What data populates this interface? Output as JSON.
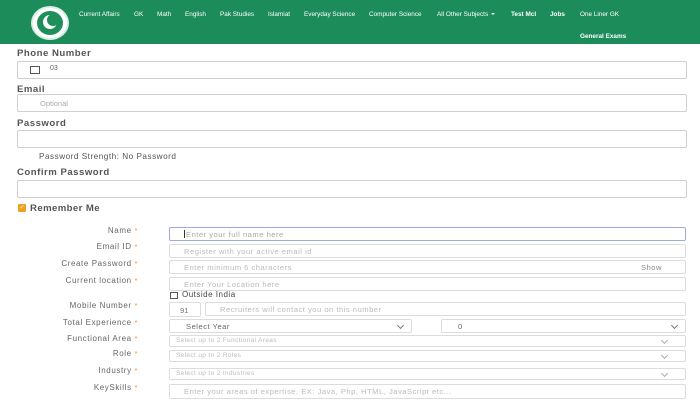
{
  "nav": {
    "items": [
      {
        "label": "Current Affairs",
        "bold": false
      },
      {
        "label": "GK",
        "bold": false
      },
      {
        "label": "Math",
        "bold": false
      },
      {
        "label": "English",
        "bold": false
      },
      {
        "label": "Pak Studies",
        "bold": false
      },
      {
        "label": "Islamiat",
        "bold": false
      },
      {
        "label": "Everyday Science",
        "bold": false
      },
      {
        "label": "Computer Science",
        "bold": false
      },
      {
        "label": "All Other Subjects",
        "bold": false,
        "dropdown": true
      },
      {
        "label": "Test Mcl",
        "bold": true
      },
      {
        "label": "Jobs",
        "bold": true
      },
      {
        "label": "One Liner GK",
        "bold": false
      }
    ],
    "second_row": "General Exams",
    "bg_color": "#1c8c5a"
  },
  "login": {
    "phone_label": "Phone Number",
    "phone_prefix": "03",
    "email_label": "Email",
    "email_placeholder": "Optional",
    "password_label": "Password",
    "password_strength": "Password Strength: No Password",
    "confirm_label": "Confirm Password",
    "remember_label": "Remember Me"
  },
  "register": {
    "name_label": "Name",
    "name_placeholder": "Enter your full name here",
    "email_label": "Email ID",
    "email_placeholder": "Register with your active email id",
    "password_label": "Create Password",
    "password_placeholder": "Enter minimum 6 characters",
    "show_label": "Show",
    "location_label": "Current location",
    "location_placeholder": "Enter Your Location here",
    "outside_label": "Outside India",
    "mobile_label": "Mobile Number",
    "mobile_code": "91",
    "mobile_placeholder": "Recruiters will contact you on this number",
    "experience_label": "Total Experience",
    "experience_year": "Select Year",
    "experience_month": "0",
    "functional_label": "Functional Area",
    "functional_placeholder": "Select up to 2 Functional Areas",
    "role_label": "Role",
    "role_placeholder": "Select up to 2 Roles",
    "industry_label": "Industry",
    "industry_placeholder": "Select up to 2 Industries",
    "skills_label": "KeySkills",
    "skills_placeholder": "Enter your areas of expertise. EX: Java, Php, HTML, JavaScript etc...",
    "required_mark": "*",
    "accent_color": "#f08a24"
  }
}
